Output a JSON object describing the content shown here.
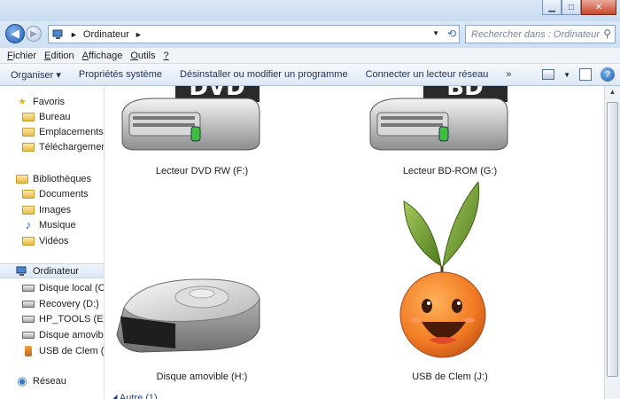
{
  "window": {
    "minimize_glyph": "▁",
    "maximize_glyph": "□",
    "close_glyph": "✕"
  },
  "address": {
    "path_arrow": "►",
    "location": "Ordinateur",
    "crumb_arrow": "►",
    "search_placeholder": "Rechercher dans : Ordinateur"
  },
  "menu": [
    {
      "underline": "F",
      "rest": "ichier"
    },
    {
      "underline": "E",
      "rest": "dition"
    },
    {
      "underline": "A",
      "rest": "ffichage"
    },
    {
      "underline": "O",
      "rest": "utils"
    },
    {
      "underline": "?",
      "rest": ""
    }
  ],
  "toolbar": {
    "organize": "Organiser ▾",
    "properties": "Propriétés système",
    "uninstall": "Désinstaller ou modifier un programme",
    "map_drive": "Connecter un lecteur réseau",
    "more": "»"
  },
  "sidebar": {
    "favorites": "Favoris",
    "desktop": "Bureau",
    "recent": "Emplacements récents",
    "downloads": "Téléchargements",
    "libraries": "Bibliothèques",
    "documents": "Documents",
    "images": "Images",
    "music": "Musique",
    "videos": "Vidéos",
    "computer": "Ordinateur",
    "local_disk": "Disque local (C:)",
    "recovery": "Recovery (D:)",
    "hp_tools": "HP_TOOLS (E:)",
    "removable": "Disque amovible (H:)",
    "usb": "USB de Clem (J:)",
    "network": "Réseau"
  },
  "drives": {
    "dvd_label": "Lecteur DVD RW (F:)",
    "dvd_badge": "DVD",
    "bd_label": "Lecteur BD-ROM (G:)",
    "bd_badge": "BD",
    "removable_label": "Disque amovible (H:)",
    "usb_label": "USB de Clem (J:)"
  },
  "group": {
    "other": "◢ Autre (1)"
  },
  "colors": {
    "accent": "#1f5db4",
    "orange": "#f07a22",
    "leaf": "#5d8a2a"
  }
}
